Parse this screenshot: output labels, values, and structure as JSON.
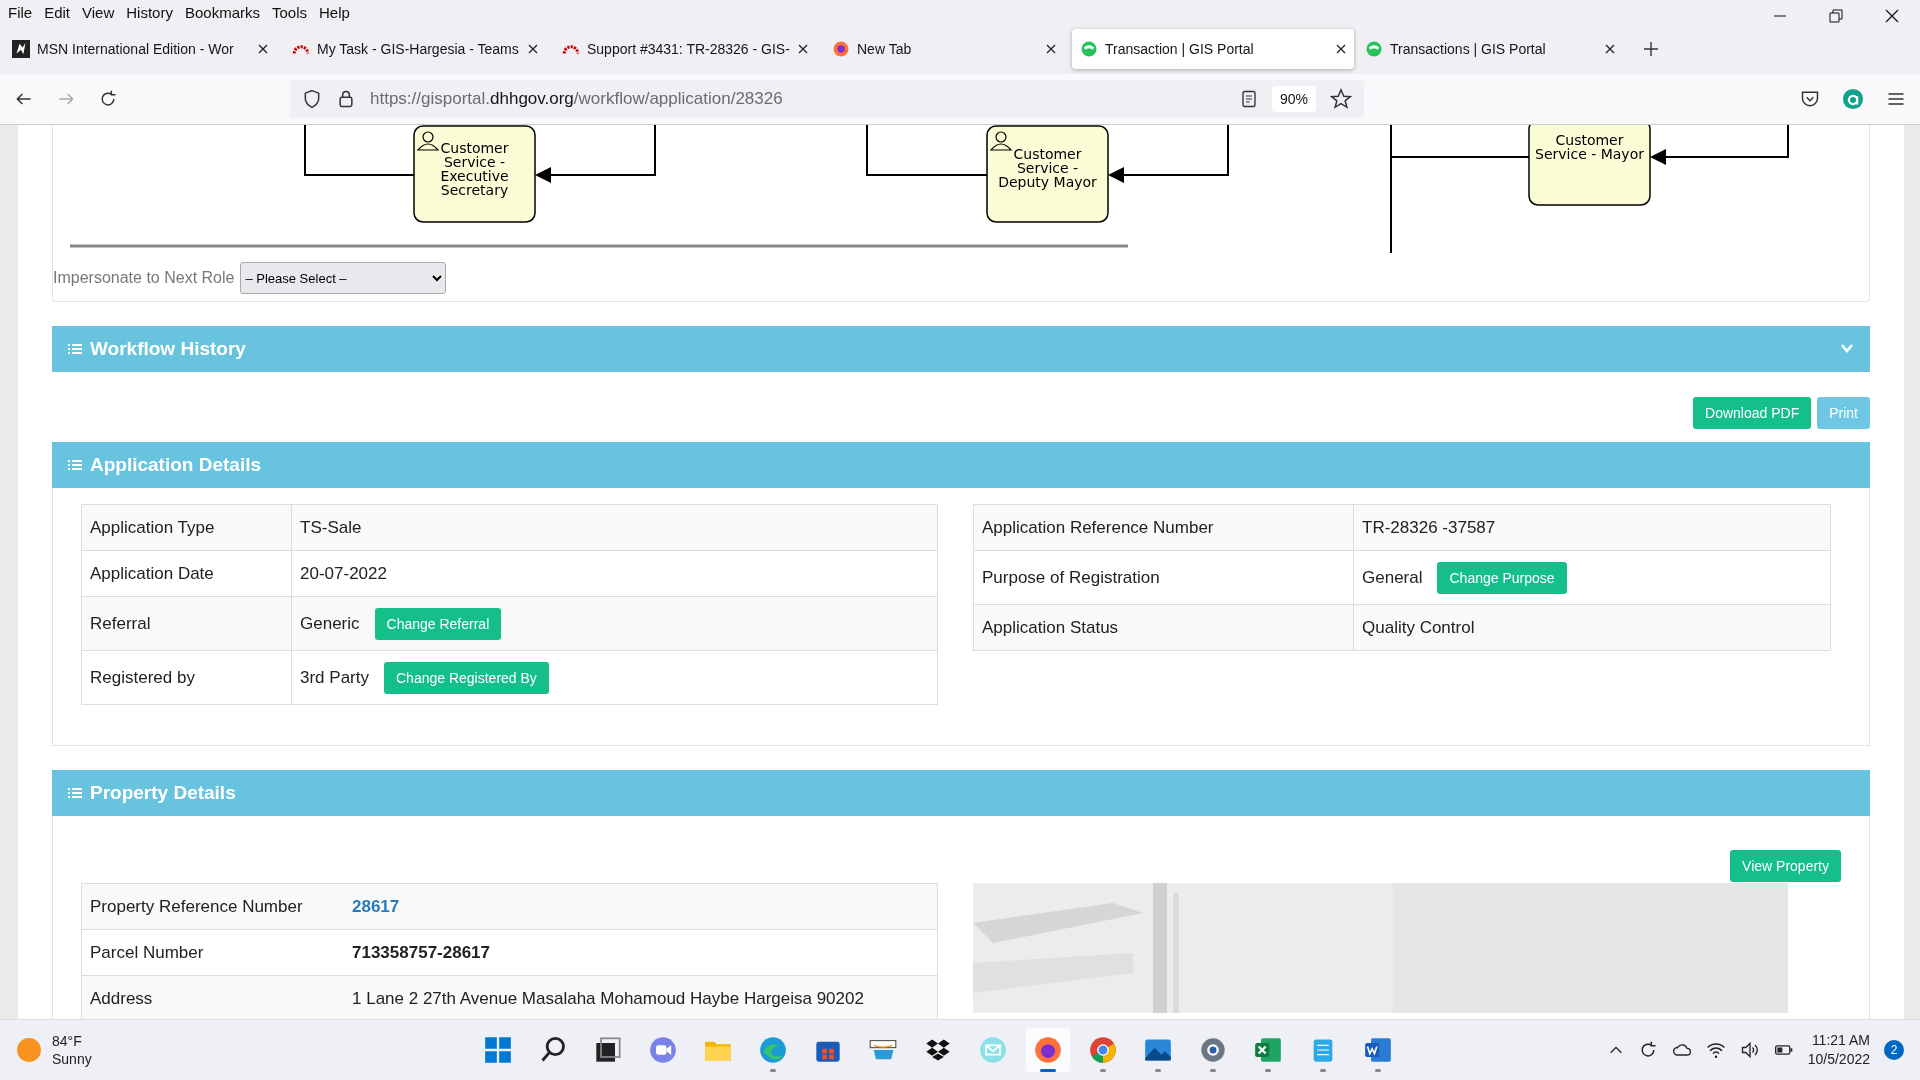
{
  "menu": [
    "File",
    "Edit",
    "View",
    "History",
    "Bookmarks",
    "Tools",
    "Help"
  ],
  "tabs": [
    {
      "kind": "msn",
      "title": "MSN International Edition - Wor",
      "selected": false
    },
    {
      "kind": "redmine",
      "title": "My Task - GIS-Hargesia - Teams",
      "selected": false
    },
    {
      "kind": "redmine",
      "title": "Support #3431: TR-28326 - GIS-",
      "selected": false
    },
    {
      "kind": "firefox",
      "title": "New Tab",
      "selected": false
    },
    {
      "kind": "gis",
      "title": "Transaction | GIS Portal",
      "selected": true
    },
    {
      "kind": "gis",
      "title": "Transactions | GIS Portal",
      "selected": false
    }
  ],
  "address": {
    "scheme": "https://gisportal.",
    "domain": "dhhgov.org",
    "path": "/workflow/application/28326",
    "zoom": "90%"
  },
  "diagram": {
    "nodes": [
      {
        "lines": [
          "Customer",
          "Service -",
          "Executive",
          "Secretary"
        ],
        "icon": true
      },
      {
        "lines": [
          "Customer",
          "Service -",
          "Deputy Mayor"
        ],
        "icon": true
      },
      {
        "lines": [
          "Customer",
          "Service - Mayor"
        ],
        "icon": false
      }
    ]
  },
  "impersonate": {
    "label": "Impersonate to Next Role",
    "value": "– Please Select –"
  },
  "workflow_history": {
    "title": "Workflow History",
    "expanded": false
  },
  "actions": [
    "Download PDF",
    "Print"
  ],
  "application_details": {
    "title": "Application Details",
    "left": [
      {
        "label": "Application Type",
        "value": "TS-Sale"
      },
      {
        "label": "Application Date",
        "value": "20-07-2022"
      },
      {
        "label": "Referral",
        "value": "Generic",
        "action": "Change Referral"
      },
      {
        "label": "Registered by",
        "value": "3rd Party",
        "action": "Change Registered By"
      }
    ],
    "right": [
      {
        "label": "Application Reference Number",
        "value": "TR-28326 -37587"
      },
      {
        "label": "Purpose of Registration",
        "value": "General",
        "action": "Change Purpose"
      },
      {
        "label": "Application Status",
        "value": "Quality Control"
      }
    ]
  },
  "property_details": {
    "title": "Property Details",
    "button": "View Property",
    "rows": [
      {
        "label": "Property Reference Number",
        "value": "28617",
        "kind": "link"
      },
      {
        "label": "Parcel Number",
        "value": "713358757-28617",
        "kind": "bold"
      },
      {
        "label": "Address",
        "value": "1 Lane 2 27th Avenue Masalaha Mohamoud Haybe Hargeisa 90202",
        "kind": "plain"
      }
    ]
  },
  "taskbar": {
    "temperature": "84°F",
    "condition": "Sunny",
    "apps": [
      {
        "kind": "start",
        "selected": false
      },
      {
        "kind": "search",
        "selected": false
      },
      {
        "kind": "taskview",
        "selected": false
      },
      {
        "kind": "chat",
        "selected": false
      },
      {
        "kind": "explorer",
        "selected": false
      },
      {
        "kind": "edge",
        "selected": false
      },
      {
        "kind": "store",
        "selected": false
      },
      {
        "kind": "amazon",
        "selected": false
      },
      {
        "kind": "dropbox",
        "selected": false
      },
      {
        "kind": "mail",
        "selected": false
      },
      {
        "kind": "firefox",
        "selected": true
      },
      {
        "kind": "chrome",
        "selected": false
      },
      {
        "kind": "photos",
        "selected": false
      },
      {
        "kind": "settings",
        "selected": false
      },
      {
        "kind": "excel",
        "selected": false
      },
      {
        "kind": "notepad",
        "selected": false
      },
      {
        "kind": "word",
        "selected": false
      }
    ],
    "time": "11:21 AM",
    "date": "10/5/2022",
    "notifications": "2"
  }
}
